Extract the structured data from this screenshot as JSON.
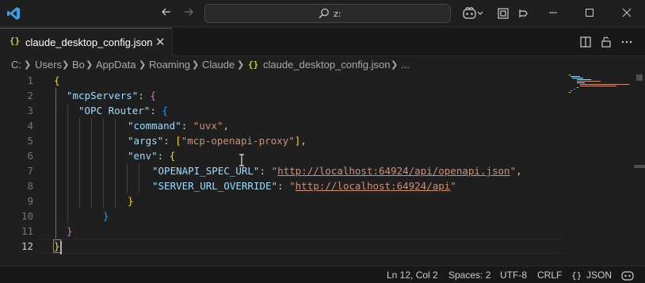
{
  "titlebar": {
    "search_text": "z:",
    "icons": [
      "vscode-logo-icon",
      "arrow-left-icon",
      "arrow-right-icon",
      "search-icon",
      "copilot-icon",
      "chevron-down-icon",
      "layout-icon",
      "pin-icon",
      "minimize-icon",
      "maximize-icon",
      "close-icon"
    ]
  },
  "tab": {
    "icon_glyph": "{}",
    "label": "claude_desktop_config.json",
    "close_glyph": "✕"
  },
  "breadcrumb": {
    "segments": [
      "C:",
      "Users",
      "Bo",
      "AppData",
      "Roaming",
      "Claude"
    ],
    "file_glyph": "{}",
    "file": "claude_desktop_config.json",
    "more": "..."
  },
  "editor": {
    "line_numbers": [
      "1",
      "2",
      "3",
      "4",
      "5",
      "6",
      "7",
      "8",
      "9",
      "10",
      "11",
      "12"
    ],
    "active_line": "12",
    "code": {
      "l1_open": "{",
      "l2_key": "\"mcpServers\"",
      "l2_colon": ": ",
      "l2_open": "{",
      "l3_key": "\"OPC Router\"",
      "l3_colon": ": ",
      "l3_open": "{",
      "l4_key": "\"command\"",
      "l4_colon": ": ",
      "l4_val": "\"uvx\"",
      "l4_comma": ",",
      "l5_key": "\"args\"",
      "l5_colon": ": ",
      "l5_open": "[",
      "l5_val": "\"mcp-openapi-proxy\"",
      "l5_close": "]",
      "l5_comma": ",",
      "l6_key": "\"env\"",
      "l6_colon": ": ",
      "l6_open": "{",
      "l7_key": "\"OPENAPI_SPEC_URL\"",
      "l7_colon": ": ",
      "l7_q1": "\"",
      "l7_url": "http://localhost:64924/api/openapi.json",
      "l7_q2": "\"",
      "l7_comma": ",",
      "l8_key": "\"SERVER_URL_OVERRIDE\"",
      "l8_colon": ": ",
      "l8_q1": "\"",
      "l8_url": "http://localhost:64924/api",
      "l8_q2": "\"",
      "l9_close": "}",
      "l10_close": "}",
      "l11_close": "}",
      "l12_close": "}"
    }
  },
  "statusbar": {
    "position": "Ln 12, Col 2",
    "spaces": "Spaces: 2",
    "encoding": "UTF-8",
    "eol": "CRLF",
    "lang_glyph": "{}",
    "language": "JSON"
  },
  "colors": {
    "accent": "#0078d4",
    "bracket_gold": "#ffd700",
    "bracket_orchid": "#da70d6",
    "bracket_blue": "#179fff",
    "key": "#9cdcfe",
    "string": "#ce9178"
  }
}
